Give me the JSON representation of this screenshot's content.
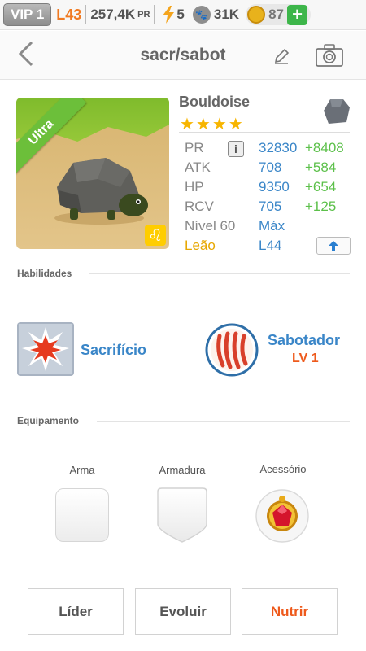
{
  "status_bar": {
    "vip": "VIP 1",
    "level": "L43",
    "pr_value": "257,4K",
    "pr_unit": "PR",
    "energy": "5",
    "paws": "31K",
    "coins": "87",
    "plus": "+"
  },
  "header": {
    "title": "sacr/sabot",
    "back_icon": "chevron-left-icon",
    "edit_icon": "pencil-icon",
    "camera_icon": "camera-icon"
  },
  "pet": {
    "rarity": "Ultra",
    "name": "Bouldoise",
    "stars": "★★★★",
    "star_count": 4,
    "element_icon": "rock-element-icon",
    "zodiac_symbol": "♌"
  },
  "stats": [
    {
      "label": "PR",
      "value": "32830",
      "bonus": "+8408"
    },
    {
      "label": "ATK",
      "value": "708",
      "bonus": "+584"
    },
    {
      "label": "HP",
      "value": "9350",
      "bonus": "+654"
    },
    {
      "label": "RCV",
      "value": "705",
      "bonus": "+125"
    }
  ],
  "level_row": {
    "label": "Nível 60",
    "value": "Máx"
  },
  "sign_row": {
    "label": "Leão",
    "value": "L44"
  },
  "info_button": "i",
  "sections": {
    "abilities": "Habilidades",
    "equipment": "Equipamento"
  },
  "abilities": [
    {
      "name": "Sacrifício",
      "icon": "explosion-icon"
    },
    {
      "name": "Sabotador",
      "level": "LV 1",
      "icon": "claw-marks-icon"
    }
  ],
  "equipment": [
    {
      "label": "Arma",
      "icon": "empty-slot"
    },
    {
      "label": "Armadura",
      "icon": "shield-slot"
    },
    {
      "label": "Acessório",
      "icon": "ruby-amulet-icon"
    }
  ],
  "buttons": {
    "leader": "Líder",
    "evolve": "Evoluir",
    "feed": "Nutrir"
  },
  "colors": {
    "accent_blue": "#3a86c8",
    "bonus_green": "#5cc04a",
    "orange": "#ee5a1c",
    "gold": "#e7a700",
    "ultra_green": "#6cbf3a"
  }
}
